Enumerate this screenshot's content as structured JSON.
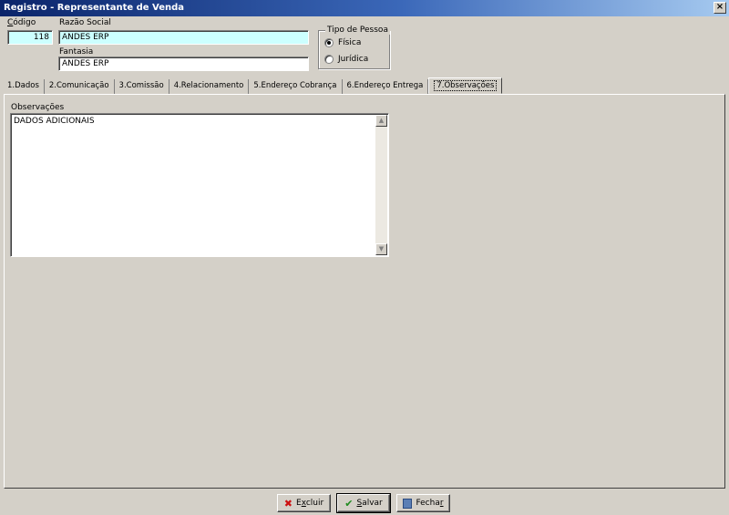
{
  "window": {
    "title": "Registro - Representante de Venda",
    "close_label": "×"
  },
  "header": {
    "codigo_label": "Código",
    "codigo_value": "118",
    "razao_social_label": "Razão Social",
    "razao_social_value": "ANDES ERP",
    "fantasia_label": "Fantasia",
    "fantasia_value": "ANDES ERP"
  },
  "tipo_pessoa": {
    "title": "Tipo de Pessoa",
    "options": [
      {
        "label": "Física",
        "selected": true
      },
      {
        "label": "Jurídica",
        "selected": false
      }
    ]
  },
  "tabs": [
    {
      "label": "1.Dados"
    },
    {
      "label": "2.Comunicação"
    },
    {
      "label": "3.Comissão"
    },
    {
      "label": "4.Relacionamento"
    },
    {
      "label": "5.Endereço Cobrança"
    },
    {
      "label": "6.Endereço Entrega"
    },
    {
      "label": "7.Observações",
      "active": true
    }
  ],
  "observacoes": {
    "label": "Observações",
    "text": "DADOS ADICIONAIS"
  },
  "buttons": {
    "excluir": {
      "pre": "E",
      "accel": "x",
      "post": "cluir",
      "icon": "delete-x-icon"
    },
    "salvar": {
      "pre": "",
      "accel": "S",
      "post": "alvar",
      "icon": "checkmark-icon"
    },
    "fechar": {
      "pre": "Fecha",
      "accel": "r",
      "post": "",
      "icon": "door-exit-icon"
    }
  },
  "colors": {
    "title_start": "#0a246a",
    "title_end": "#a6caf0",
    "highlight_field": "#ccffff",
    "delete_red": "#cc1111",
    "save_green": "#1f8a1f"
  }
}
